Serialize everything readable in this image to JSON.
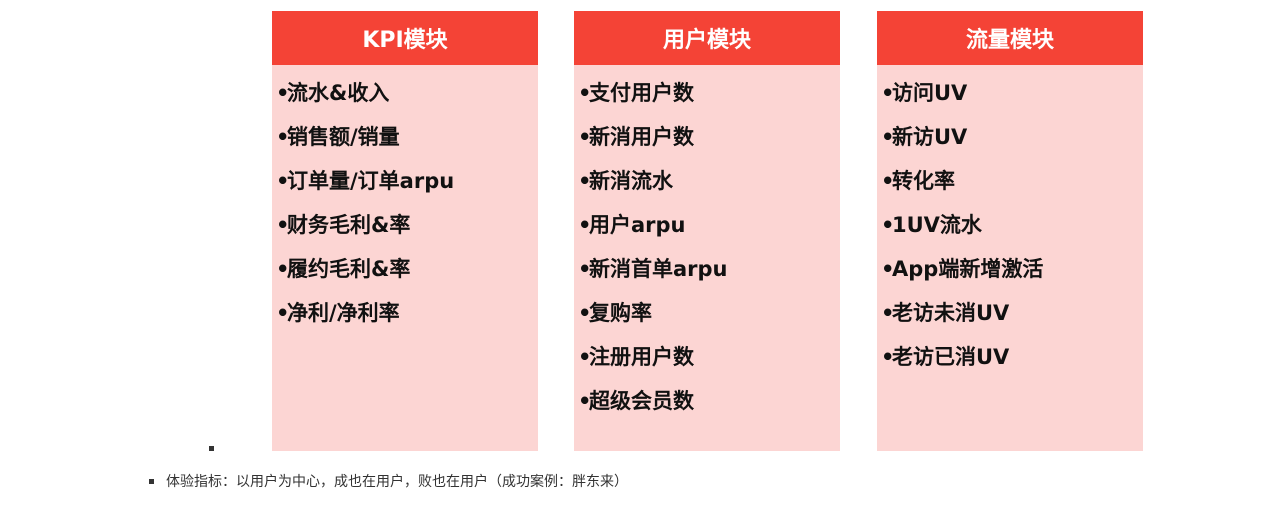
{
  "modules": [
    {
      "title": "KPI模块",
      "items": [
        "流水&收入",
        "销售额/销量",
        "订单量/订单arpu",
        "财务毛利&率",
        "履约毛利&率",
        "净利/净利率"
      ]
    },
    {
      "title": "用户模块",
      "items": [
        "支付用户数",
        "新消用户数",
        "新消流水",
        "用户arpu",
        "新消首单arpu",
        "复购率",
        "注册用户数",
        "超级会员数"
      ]
    },
    {
      "title": "流量模块",
      "items": [
        "访问UV",
        "新访UV",
        "转化率",
        "1UV流水",
        "App端新增激活",
        "老访未消UV",
        "老访已消UV"
      ]
    }
  ],
  "bullet_char": "•",
  "footnote": "体验指标：以用户为中心，成也在用户，败也在用户（成功案例：胖东来）",
  "colors": {
    "header_bg": "#f44336",
    "panel_bg": "#fcd5d3",
    "header_text": "#ffffff"
  }
}
